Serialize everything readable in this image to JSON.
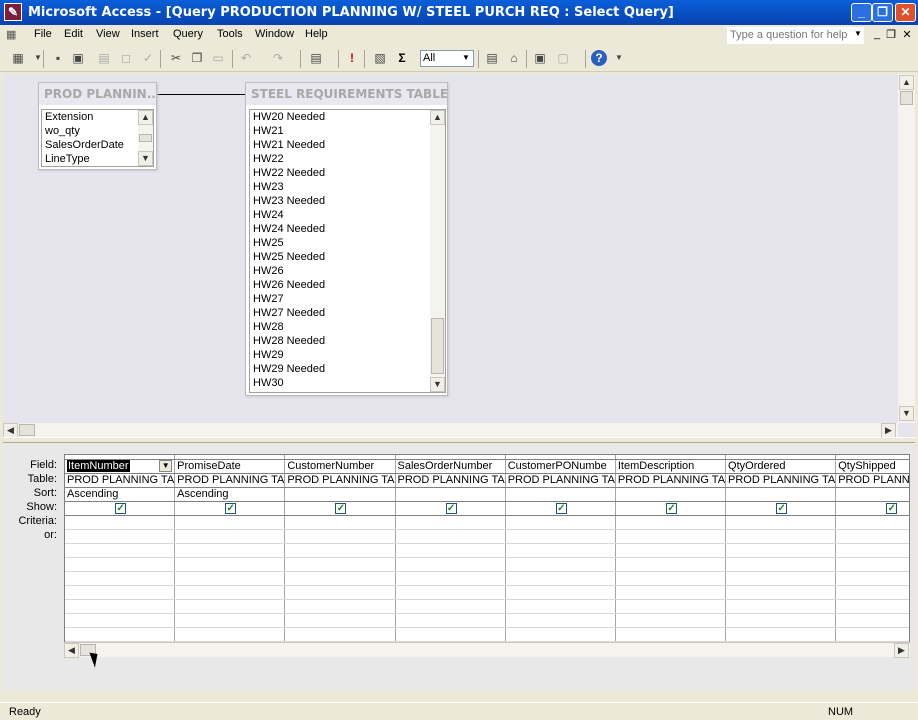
{
  "window": {
    "title": "Microsoft Access - [Query PRODUCTION PLANNING W/ STEEL PURCH REQ : Select Query]",
    "app_icon_glyph": "✎",
    "minimize_glyph": "_",
    "restore_glyph": "❐",
    "close_glyph": "✕"
  },
  "menu": {
    "items": [
      "File",
      "Edit",
      "View",
      "Insert",
      "Query",
      "Tools",
      "Window",
      "Help"
    ],
    "help_placeholder": "Type a question for help",
    "mdi_minimize": "_",
    "mdi_restore": "❐",
    "mdi_close": "✕"
  },
  "toolbar": {
    "top_values": "All",
    "sigma_glyph": "Σ",
    "run_glyph": "!",
    "help_glyph": "?"
  },
  "field_lists": {
    "prod": {
      "title": "PROD PLANNIN...",
      "fields": [
        "Extension",
        "wo_qty",
        "SalesOrderDate",
        "LineType"
      ]
    },
    "steel": {
      "title": "STEEL REQUIREMENTS TABLE",
      "fields": [
        "HW20 Needed",
        "HW21",
        "HW21 Needed",
        "HW22",
        "HW22 Needed",
        "HW23",
        "HW23 Needed",
        "HW24",
        "HW24 Needed",
        "HW25",
        "HW25 Needed",
        "HW26",
        "HW26 Needed",
        "HW27",
        "HW27 Needed",
        "HW28",
        "HW28 Needed",
        "HW29",
        "HW29 Needed",
        "HW30"
      ]
    }
  },
  "grid": {
    "row_labels": [
      "Field:",
      "Table:",
      "Sort:",
      "Show:",
      "Criteria:",
      "or:"
    ],
    "columns": [
      {
        "field": "ItemNumber",
        "table": "PROD PLANNING TA",
        "sort": "Ascending",
        "show": true
      },
      {
        "field": "PromiseDate",
        "table": "PROD PLANNING TA",
        "sort": "Ascending",
        "show": true
      },
      {
        "field": "CustomerNumber",
        "table": "PROD PLANNING TA",
        "sort": "",
        "show": true
      },
      {
        "field": "SalesOrderNumber",
        "table": "PROD PLANNING TA",
        "sort": "",
        "show": true
      },
      {
        "field": "CustomerPONumbe",
        "table": "PROD PLANNING TA",
        "sort": "",
        "show": true
      },
      {
        "field": "ItemDescription",
        "table": "PROD PLANNING TA",
        "sort": "",
        "show": true
      },
      {
        "field": "QtyOrdered",
        "table": "PROD PLANNING TA",
        "sort": "",
        "show": true
      },
      {
        "field": "QtyShipped",
        "table": "PROD PLANNING TA",
        "sort": "",
        "show": true
      }
    ]
  },
  "statusbar": {
    "left": "Ready",
    "num": "NUM"
  }
}
